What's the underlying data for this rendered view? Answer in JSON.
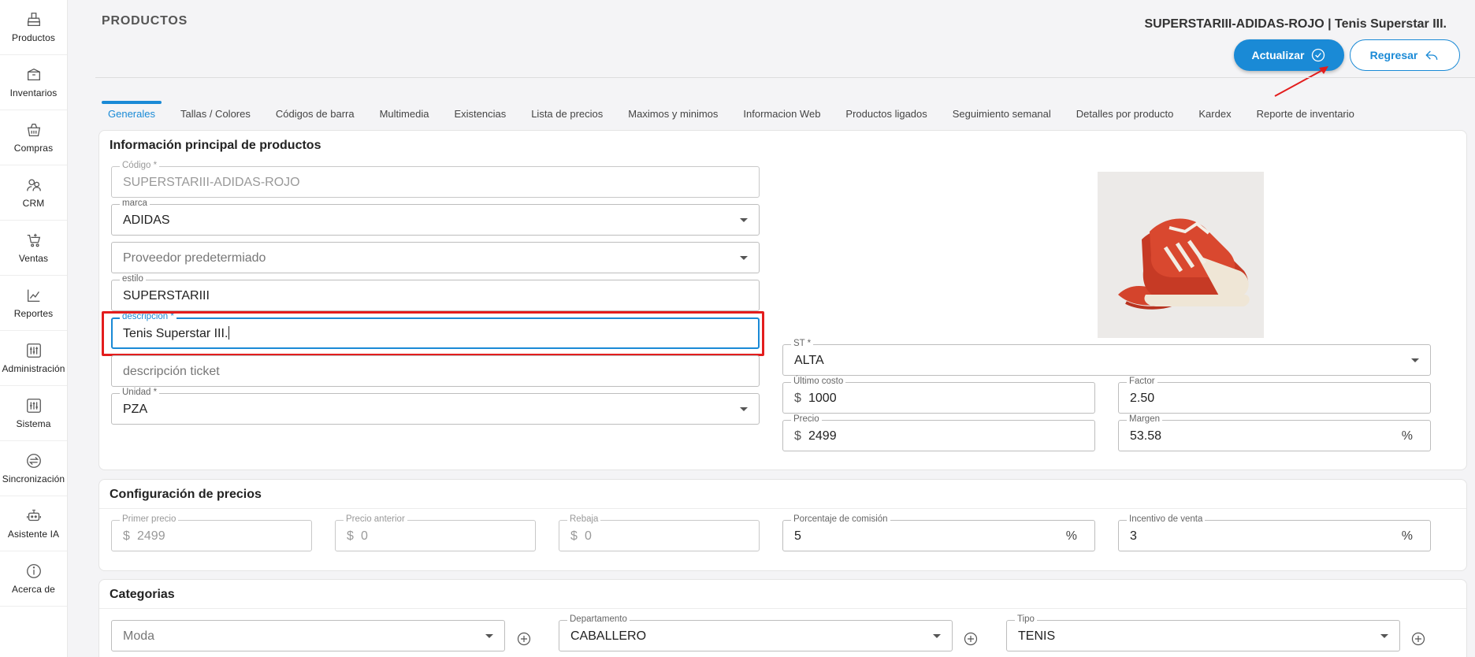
{
  "sidebar": {
    "items": [
      {
        "label": "Productos",
        "icon": "productos-icon"
      },
      {
        "label": "Inventarios",
        "icon": "inventarios-icon"
      },
      {
        "label": "Compras",
        "icon": "compras-icon"
      },
      {
        "label": "CRM",
        "icon": "crm-icon"
      },
      {
        "label": "Ventas",
        "icon": "ventas-icon"
      },
      {
        "label": "Reportes",
        "icon": "reportes-icon"
      },
      {
        "label": "Administración",
        "icon": "administracion-icon"
      },
      {
        "label": "Sistema",
        "icon": "sistema-icon"
      },
      {
        "label": "Sincronización",
        "icon": "sincronizacion-icon"
      },
      {
        "label": "Asistente IA",
        "icon": "asistente-icon"
      },
      {
        "label": "Acerca de",
        "icon": "info-icon"
      }
    ]
  },
  "header": {
    "title": "PRODUCTOS",
    "product_name": "SUPERSTARIII-ADIDAS-ROJO | Tenis Superstar III.",
    "update_label": "Actualizar",
    "back_label": "Regresar"
  },
  "tabs": [
    {
      "label": "Generales"
    },
    {
      "label": "Tallas / Colores"
    },
    {
      "label": "Códigos de barra"
    },
    {
      "label": "Multimedia"
    },
    {
      "label": "Existencias"
    },
    {
      "label": "Lista de precios"
    },
    {
      "label": "Maximos y minimos"
    },
    {
      "label": "Informacion Web"
    },
    {
      "label": "Productos ligados"
    },
    {
      "label": "Seguimiento semanal"
    },
    {
      "label": "Detalles por producto"
    },
    {
      "label": "Kardex"
    },
    {
      "label": "Reporte de inventario"
    }
  ],
  "info": {
    "title": "Información principal de productos",
    "codigo": {
      "label": "Código *",
      "value": "SUPERSTARIII-ADIDAS-ROJO"
    },
    "marca": {
      "label": "marca",
      "value": "ADIDAS"
    },
    "proveedor": {
      "placeholder": "Proveedor predetermiado"
    },
    "estilo": {
      "label": "estilo",
      "value": "SUPERSTARIII"
    },
    "descripcion": {
      "label": "descripcion *",
      "value": "Tenis Superstar III."
    },
    "descripcion_ticket": {
      "placeholder": "descripción ticket"
    },
    "unidad": {
      "label": "Unidad *",
      "value": "PZA"
    },
    "st": {
      "label": "ST *",
      "value": "ALTA"
    },
    "ultimo_costo": {
      "label": "Último costo",
      "prefix": "$",
      "value": "1000"
    },
    "factor": {
      "label": "Factor",
      "value": "2.50"
    },
    "precio": {
      "label": "Precio",
      "prefix": "$",
      "value": "2499"
    },
    "margen": {
      "label": "Margen",
      "value": "53.58",
      "suffix": "%"
    }
  },
  "precios": {
    "title": "Configuración de precios",
    "primer_precio": {
      "label": "Primer precio",
      "prefix": "$",
      "value": "2499"
    },
    "precio_anterior": {
      "label": "Precio anterior",
      "prefix": "$",
      "value": "0"
    },
    "rebaja": {
      "label": "Rebaja",
      "prefix": "$",
      "value": "0"
    },
    "comision": {
      "label": "Porcentaje de comisión",
      "value": "5",
      "suffix": "%"
    },
    "incentivo": {
      "label": "Incentivo de venta",
      "value": "3",
      "suffix": "%"
    }
  },
  "categorias": {
    "title": "Categorias",
    "moda": {
      "value": "Moda"
    },
    "departamento": {
      "label": "Departamento",
      "value": "CABALLERO"
    },
    "tipo": {
      "label": "Tipo",
      "value": "TENIS"
    }
  },
  "colors": {
    "accent": "#1a8ad6",
    "highlight": "#e31d1d",
    "remove": "#d9242b"
  }
}
